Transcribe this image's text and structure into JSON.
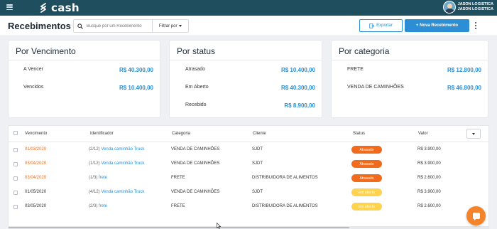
{
  "app": {
    "logo_text": "cash"
  },
  "user": {
    "line1": "JASON LOGISTICA",
    "line2": "JASON LOGISTICA"
  },
  "header": {
    "title": "Recebimentos",
    "search_placeholder": "Busque por um Recebimento",
    "filter_label": "Filtrar por",
    "export_label": "Exportar",
    "new_label": "+ Nova Recebimento"
  },
  "cards": {
    "vencimento": {
      "title": "Por Vencimento",
      "rows": [
        {
          "label": "A Vencer",
          "value": "R$ 40.300,00"
        },
        {
          "label": "Vencidos",
          "value": "R$ 10.400,00"
        }
      ]
    },
    "status": {
      "title": "Por status",
      "rows": [
        {
          "label": "Atrasado",
          "value": "R$ 10.400,00"
        },
        {
          "label": "Em Aberto",
          "value": "R$ 40.300,00"
        },
        {
          "label": "Recebido",
          "value": "R$ 8.900,00"
        }
      ]
    },
    "categoria": {
      "title": "Por categoria",
      "rows": [
        {
          "label": "FRETE",
          "value": "R$ 12.800,00"
        },
        {
          "label": "VENDA DE CAMINHÕES",
          "value": "R$ 46.800,00"
        }
      ]
    }
  },
  "table": {
    "columns": [
      "Vencimento",
      "Identificador",
      "Categoria",
      "Cliente",
      "Status",
      "Valor"
    ],
    "rows": [
      {
        "date": "01/03/2020",
        "overdue": true,
        "parcel": "(2/12)",
        "ident": "Venda caminhão Truck",
        "category": "VENDA DE CAMINHÕES",
        "client": "SJDT",
        "status": "Atrasado",
        "status_kind": "atrasado",
        "value": "R$ 3.900,00"
      },
      {
        "date": "03/04/2020",
        "overdue": true,
        "parcel": "(1/12)",
        "ident": "Venda caminhão Truck",
        "category": "VENDA DE CAMINHÕES",
        "client": "SJDT",
        "status": "Atrasado",
        "status_kind": "atrasado",
        "value": "R$ 3.900,00"
      },
      {
        "date": "03/04/2020",
        "overdue": true,
        "parcel": "(1/3)",
        "ident": "frete",
        "category": "FRETE",
        "client": "DISTRIBUIDORA DE ALIMENTOS",
        "status": "Atrasado",
        "status_kind": "atrasado",
        "value": "R$ 2.600,00"
      },
      {
        "date": "01/05/2020",
        "overdue": false,
        "parcel": "(4/12)",
        "ident": "Venda caminhão Truck",
        "category": "VENDA DE CAMINHÕES",
        "client": "SJDT",
        "status": "Em aberto",
        "status_kind": "aberto",
        "value": "R$ 3.900,00"
      },
      {
        "date": "03/05/2020",
        "overdue": false,
        "parcel": "(2/3)",
        "ident": "frete",
        "category": "FRETE",
        "client": "DISTRIBUIDORA DE ALIMENTOS",
        "status": "Em aberto",
        "status_kind": "aberto",
        "value": "R$ 2.600,00"
      }
    ]
  },
  "colors": {
    "topbar": "#1f4e5e",
    "accent": "#2c8fd6",
    "overdue": "#f26b1d",
    "open": "#ffd34f",
    "chat": "#f58329"
  }
}
